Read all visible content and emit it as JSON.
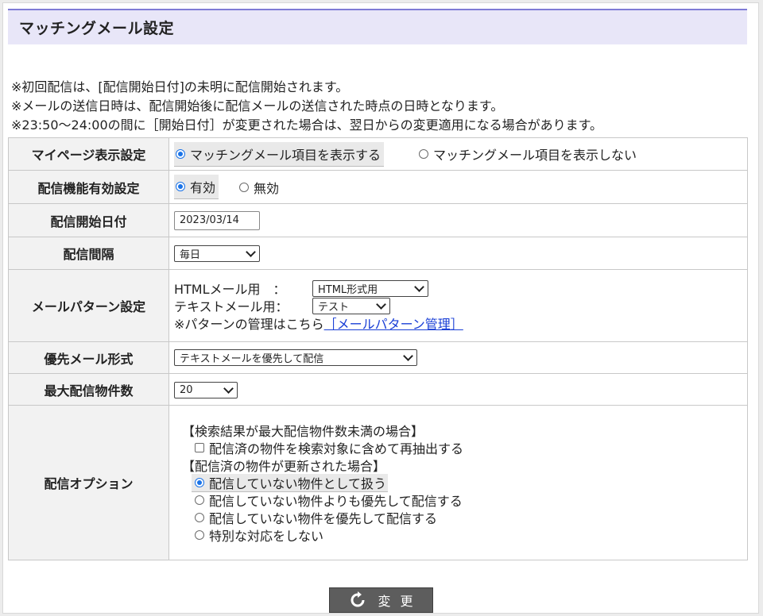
{
  "page": {
    "title": "マッチングメール設定"
  },
  "notes": [
    "※初回配信は、[配信開始日付]の未明に配信開始されます。",
    "※メールの送信日時は、配信開始後に配信メールの送信された時点の日時となります。",
    "※23:50～24:00の間に［開始日付］が変更された場合は、翌日からの変更適用になる場合があります。"
  ],
  "rows": {
    "mypage": {
      "label": "マイページ表示設定",
      "options": [
        "マッチングメール項目を表示する",
        "マッチングメール項目を表示しない"
      ],
      "selected": 0
    },
    "enabled": {
      "label": "配信機能有効設定",
      "options": [
        "有効",
        "無効"
      ],
      "selected": 0
    },
    "start_date": {
      "label": "配信開始日付",
      "value": "2023/03/14"
    },
    "interval": {
      "label": "配信間隔",
      "value": "毎日"
    },
    "pattern": {
      "label": "メールパターン設定",
      "html_label": "HTMLメール用　：",
      "html_value": "HTML形式用",
      "text_label": "テキストメール用：",
      "text_value": "テスト",
      "manage_prefix": "※パターンの管理はこちら",
      "manage_link": "［メールパターン管理］"
    },
    "priority": {
      "label": "優先メール形式",
      "value": "テキストメールを優先して配信"
    },
    "max_count": {
      "label": "最大配信物件数",
      "value": "20"
    },
    "options": {
      "label": "配信オプション",
      "heading1": "【検索結果が最大配信物件数未満の場合】",
      "checkbox_label": "配信済の物件を検索対象に含めて再抽出する",
      "checkbox_checked": false,
      "heading2": "【配信済の物件が更新された場合】",
      "radios": [
        "配信していない物件として扱う",
        "配信していない物件よりも優先して配信する",
        "配信していない物件を優先して配信する",
        "特別な対応をしない"
      ],
      "selected": 0
    }
  },
  "submit": {
    "label": "変更",
    "icon": "refresh-icon"
  },
  "colors": {
    "header_bg": "#e8e6f8",
    "header_border": "#7f7bd6",
    "accent": "#1a73e8",
    "link": "#1a3fd6",
    "button_bg": "#5d5d5d"
  }
}
